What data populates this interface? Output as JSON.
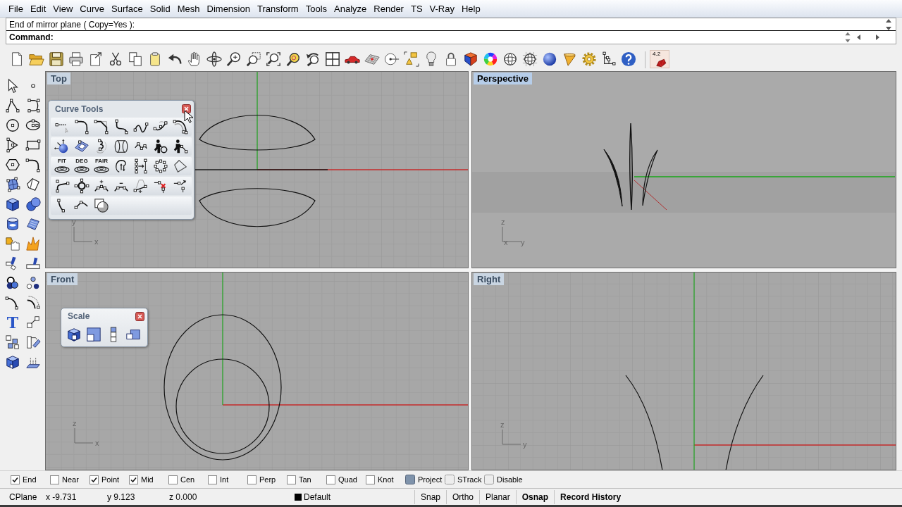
{
  "menu_bar": [
    "File",
    "Edit",
    "View",
    "Curve",
    "Surface",
    "Solid",
    "Mesh",
    "Dimension",
    "Transform",
    "Tools",
    "Analyze",
    "Render",
    "TS",
    "V-Ray",
    "Help"
  ],
  "command": {
    "history": "End of mirror plane ( Copy=Yes ):",
    "prompt": "Command:"
  },
  "toolbar": {
    "plugin_label": "4.2"
  },
  "left_toolbar": {
    "text_tool_label": "T"
  },
  "viewports": [
    {
      "kind": "top",
      "title": "Top",
      "selected": false,
      "axes": [
        "y",
        "x"
      ]
    },
    {
      "kind": "perspective",
      "title": "Perspective",
      "selected": true,
      "axes": [
        "z",
        "x",
        "y"
      ]
    },
    {
      "kind": "front",
      "title": "Front",
      "selected": false,
      "axes": [
        "z",
        "x"
      ]
    },
    {
      "kind": "right",
      "title": "Right",
      "selected": false,
      "axes": [
        "z",
        "y"
      ]
    }
  ],
  "curve_tools": {
    "title": "Curve Tools",
    "labeled_buttons": [
      "FIT",
      "DEG",
      "FAIR"
    ]
  },
  "scale_panel": {
    "title": "Scale"
  },
  "osnaps": [
    {
      "kind": "checkbox",
      "label": "End",
      "checked": true
    },
    {
      "kind": "checkbox",
      "label": "Near",
      "checked": false
    },
    {
      "kind": "checkbox",
      "label": "Point",
      "checked": true
    },
    {
      "kind": "checkbox",
      "label": "Mid",
      "checked": true
    },
    {
      "kind": "checkbox",
      "label": "Cen",
      "checked": false
    },
    {
      "kind": "checkbox",
      "label": "Int",
      "checked": false
    },
    {
      "kind": "checkbox",
      "label": "Perp",
      "checked": false
    },
    {
      "kind": "checkbox",
      "label": "Tan",
      "checked": false
    },
    {
      "kind": "checkbox",
      "label": "Quad",
      "checked": false
    },
    {
      "kind": "checkbox",
      "label": "Knot",
      "checked": false
    },
    {
      "kind": "toggle",
      "label": "Project",
      "checked": true
    },
    {
      "kind": "toggle",
      "label": "STrack",
      "checked": false
    },
    {
      "kind": "toggle",
      "label": "Disable",
      "checked": false
    }
  ],
  "status_bar": {
    "cplane": "CPlane",
    "x": "x -9.731",
    "y": "y 9.123",
    "z": "z 0.000",
    "layer": "Default",
    "panes": [
      {
        "label": "Snap",
        "on": false
      },
      {
        "label": "Ortho",
        "on": false
      },
      {
        "label": "Planar",
        "on": false
      },
      {
        "label": "Osnap",
        "on": true
      },
      {
        "label": "Record History",
        "on": true
      }
    ]
  }
}
